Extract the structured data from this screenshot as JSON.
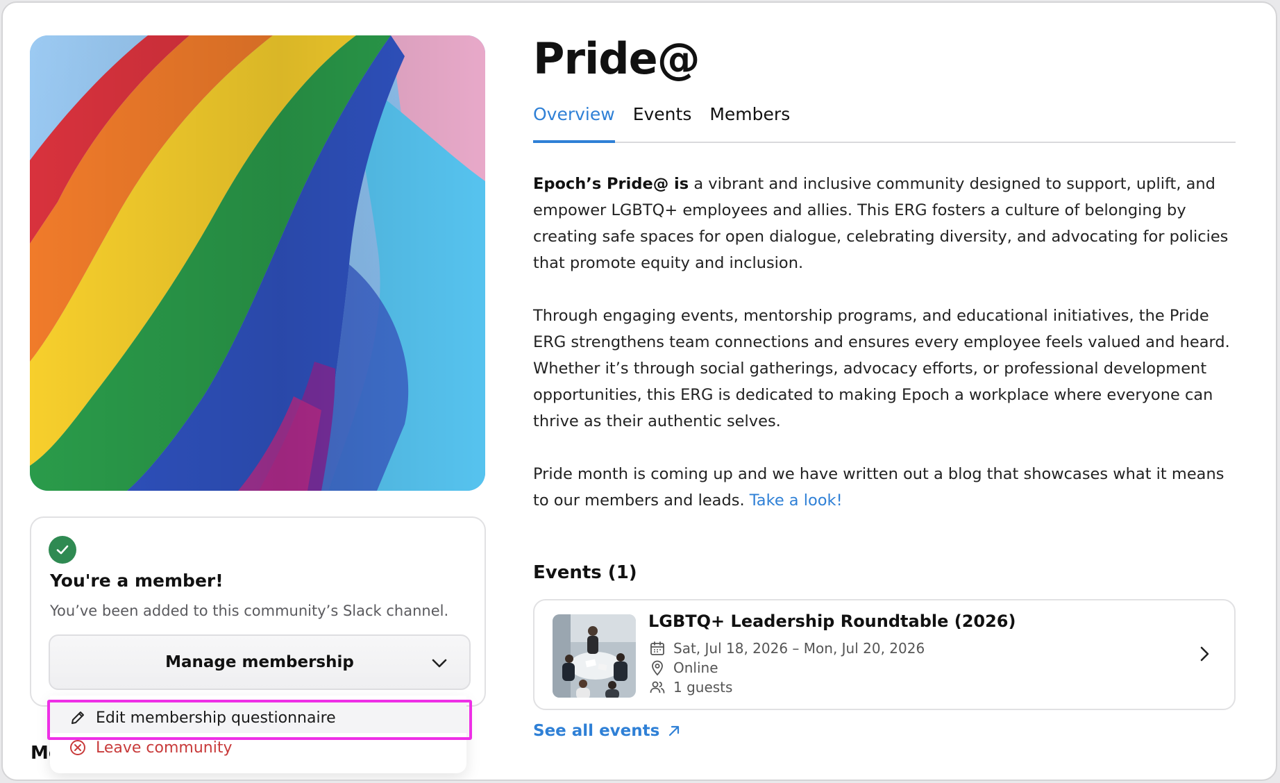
{
  "community": {
    "title": "Pride@",
    "image_alt": "Rainbow pride flag waving",
    "tabs": [
      {
        "label": "Overview",
        "active": true
      },
      {
        "label": "Events",
        "active": false
      },
      {
        "label": "Members",
        "active": false
      }
    ]
  },
  "overview": {
    "p1_bold": "Epoch’s Pride@ is",
    "p1_rest": " a vibrant and inclusive community designed to support, uplift, and empower LGBTQ+ employees and allies. This ERG fosters a culture of belonging by creating safe spaces for open dialogue, celebrating diversity, and advocating for policies that promote equity and inclusion.",
    "p2": "Through engaging events, mentorship programs, and educational initiatives, the Pride ERG strengthens team connections and ensures every employee feels valued and heard. Whether it’s through social gatherings, advocacy efforts, or professional development opportunities, this ERG is dedicated to making Epoch a workplace where everyone can thrive as their authentic selves.",
    "p3": "Pride month is coming up and we have written out a blog that showcases what it means to our members and leads. ",
    "p3_link": "Take a look!"
  },
  "membership": {
    "title": "You're a member!",
    "subtitle": "You’ve been added to this community’s Slack channel.",
    "manage_label": "Manage membership",
    "menu": {
      "edit_label": "Edit membership questionnaire",
      "leave_label": "Leave community"
    },
    "cut_heading": "Me"
  },
  "events": {
    "heading": "Events (1)",
    "items": [
      {
        "title": "LGBTQ+ Leadership Roundtable (2026)",
        "date": "Sat, Jul 18, 2026 – Mon, Jul 20, 2026",
        "location": "Online",
        "guests": "1 guests"
      }
    ],
    "see_all": "See all events"
  },
  "colors": {
    "accent": "#2f80d6",
    "success": "#2f8a52",
    "danger": "#c83a3a",
    "highlight": "#ee2fe6"
  }
}
